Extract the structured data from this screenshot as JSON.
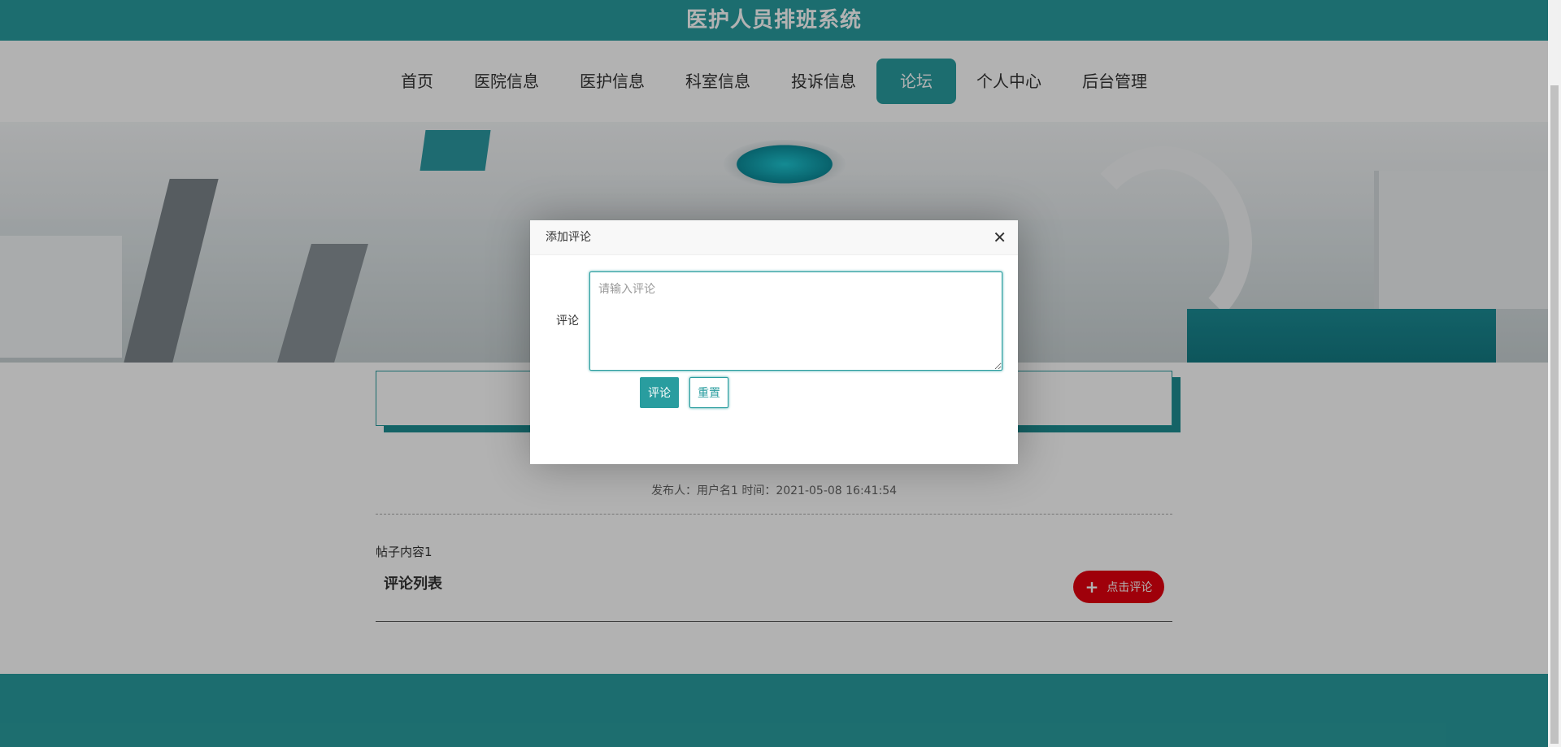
{
  "header": {
    "title": "医护人员排班系统"
  },
  "nav": {
    "items": [
      {
        "label": "首页"
      },
      {
        "label": "医院信息"
      },
      {
        "label": "医护信息"
      },
      {
        "label": "科室信息"
      },
      {
        "label": "投诉信息"
      },
      {
        "label": "论坛"
      },
      {
        "label": "个人中心"
      },
      {
        "label": "后台管理"
      }
    ],
    "active": "论坛"
  },
  "post": {
    "meta": "发布人：用户名1 时间：2021-05-08 16:41:54",
    "content": "帖子内容1",
    "comments_title": "评论列表",
    "comment_button": "点击评论"
  },
  "dialog": {
    "title": "添加评论",
    "field_label": "评论",
    "placeholder": "请输入评论",
    "value": "",
    "submit_label": "评论",
    "reset_label": "重置"
  },
  "colors": {
    "primary": "#299d9f",
    "danger": "#e4000f"
  }
}
